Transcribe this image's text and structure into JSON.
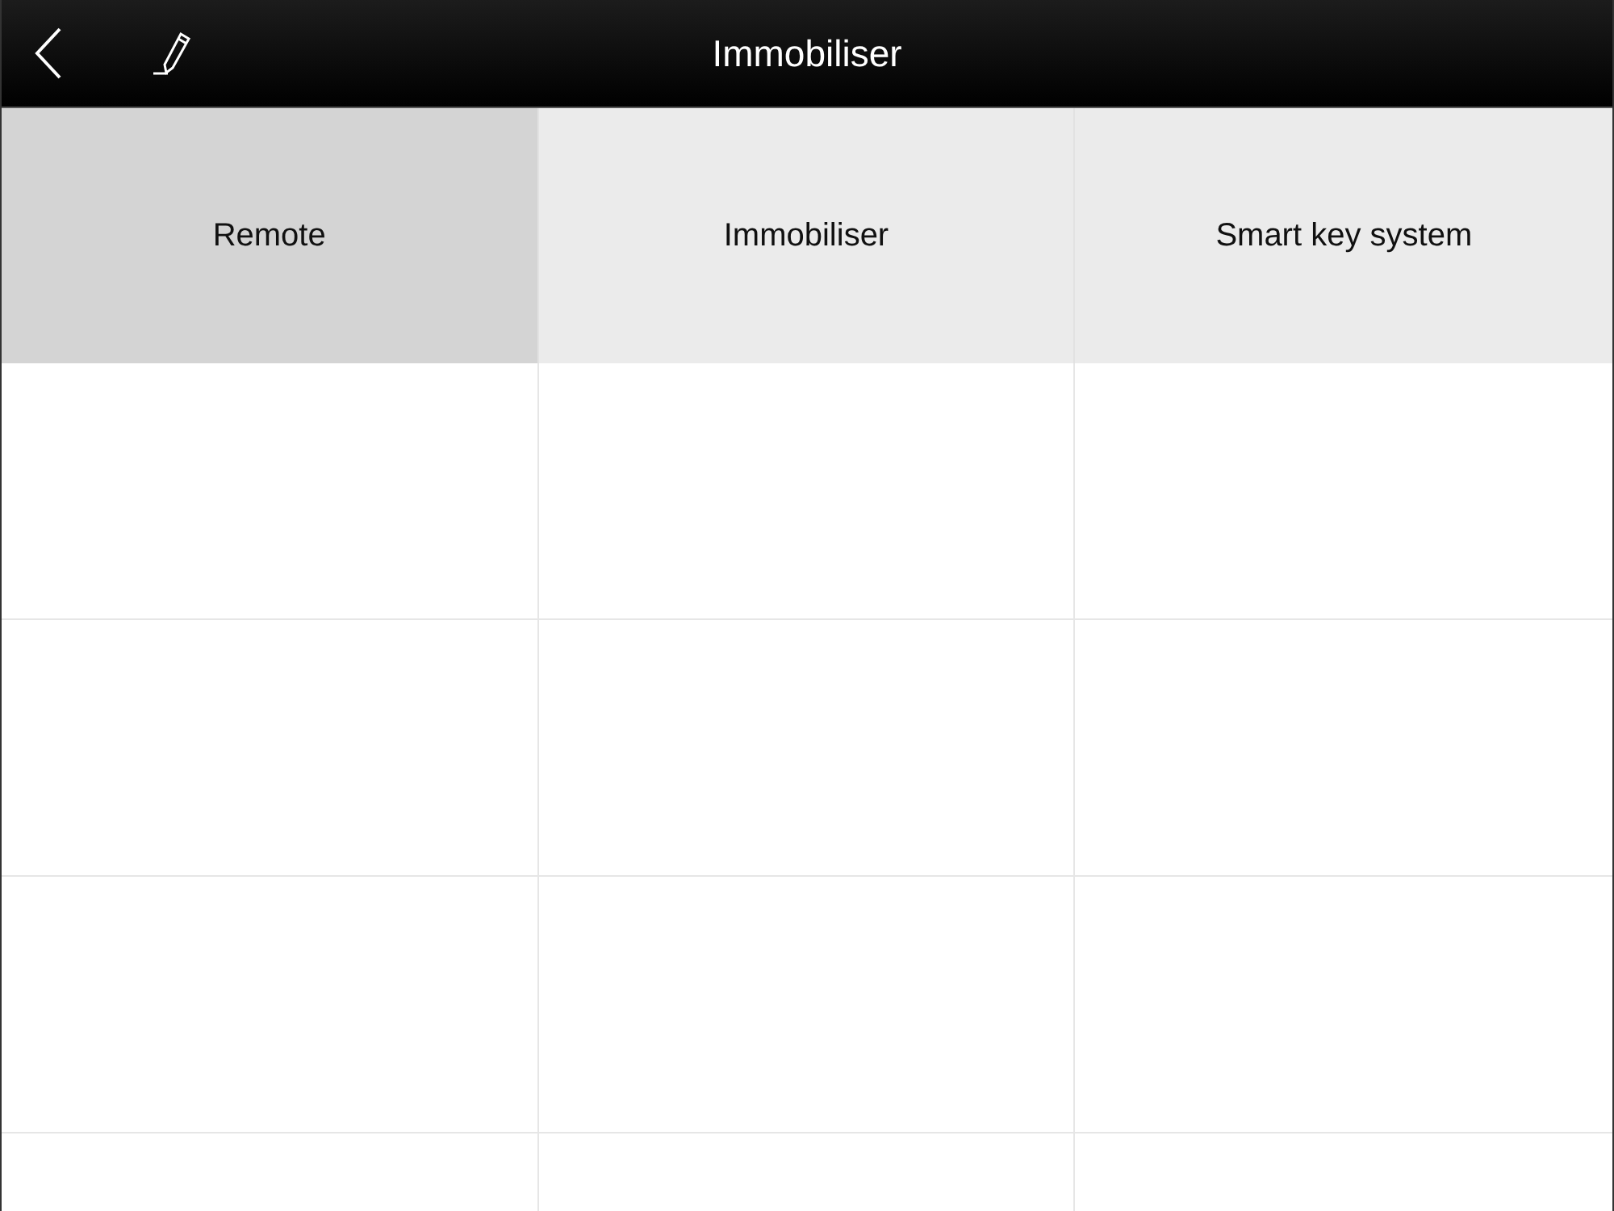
{
  "header": {
    "title": "Immobiliser"
  },
  "tabs": [
    {
      "label": "Remote",
      "selected": true
    },
    {
      "label": "Immobiliser",
      "selected": false
    },
    {
      "label": "Smart key system",
      "selected": false
    }
  ]
}
